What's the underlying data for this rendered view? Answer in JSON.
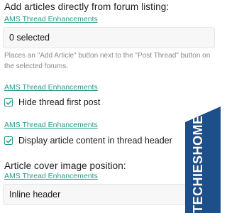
{
  "sections": {
    "forum_listing": {
      "heading": "Add articles directly from forum listing:",
      "addon_link": "AMS Thread Enhancements",
      "field_value": "0 selected",
      "hint": "Places an \"Add Article\" button next to the \"Post Thread\" button on the selected forums."
    },
    "hide_first_post": {
      "addon_link": "AMS Thread Enhancements",
      "checkbox_label": "Hide thread first post",
      "checked": true
    },
    "display_content": {
      "addon_link": "AMS Thread Enhancements",
      "checkbox_label": "Display article content in thread header",
      "checked": true
    },
    "cover_position": {
      "heading": "Article cover image position:",
      "addon_link": "AMS Thread Enhancements",
      "selected_option": "Inline header"
    }
  },
  "watermark": {
    "text": "TECHIESHOME.COM",
    "bg_color": "#1d4f8a",
    "text_color": "#ffffff"
  },
  "colors": {
    "accent": "#2b9a8b",
    "hint": "#8a8a8a"
  },
  "icons": {
    "checkbox": "check-icon",
    "select": "select-arrows-icon"
  }
}
